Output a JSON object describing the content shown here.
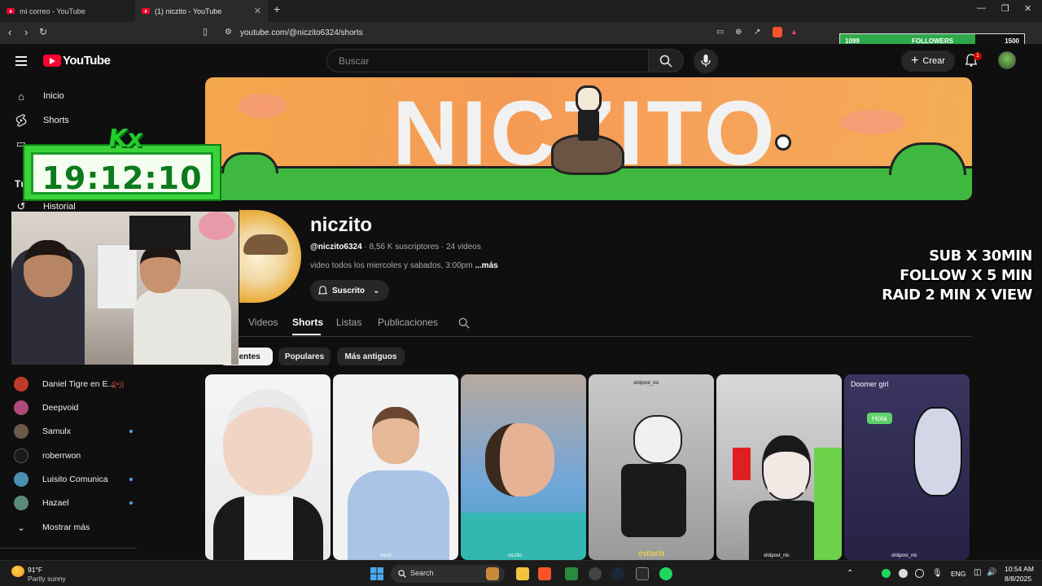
{
  "browser": {
    "tabs": [
      {
        "title": "mi correo - YouTube"
      },
      {
        "title": "(1) niczito - YouTube"
      }
    ],
    "url": "youtube.com/@niczito6324/shorts"
  },
  "header": {
    "logo": "YouTube",
    "search_placeholder": "Buscar",
    "create_label": "Crear",
    "notification_count": "1"
  },
  "followers_overlay": {
    "current": "1099",
    "label": "FOLLOWERS",
    "goal": "1500",
    "progress": 0.733
  },
  "sidebar": {
    "items": [
      {
        "label": "Inicio",
        "icon": "home-icon"
      },
      {
        "label": "Shorts",
        "icon": "shorts-icon"
      },
      {
        "label": "Historial",
        "icon": "history-icon"
      }
    ],
    "section_partial": "Tú",
    "subscriptions": [
      {
        "name": "Daniel Tigre en E...",
        "live": true,
        "color": "#c0392b"
      },
      {
        "name": "Deepvoid",
        "live": false,
        "color": "#b04a7a"
      },
      {
        "name": "Samulx",
        "live": true,
        "color": "#6b5a4a"
      },
      {
        "name": "roberrwon",
        "live": false,
        "color": "#1a1a1a"
      },
      {
        "name": "Luisito Comunica",
        "live": true,
        "color": "#4a90b0"
      },
      {
        "name": "Hazael",
        "live": true,
        "color": "#5a8a7a"
      }
    ],
    "show_more": "Mostrar más"
  },
  "banner": {
    "text": "NICZITO"
  },
  "channel": {
    "name": "niczito",
    "handle": "@niczito6324",
    "subscribers": "8,56 K suscriptores",
    "video_count": "24 videos",
    "description": "video todos los miercoles y sabados, 3:00pm",
    "more": "...más",
    "subscribed_label": "Suscrito"
  },
  "stream_overlay": {
    "lines": [
      "SUB X 30MIN",
      "FOLLOW X 5 MIN",
      "RAID 2 MIN X VIEW"
    ],
    "timer": "19:12:10",
    "logo": "Kx"
  },
  "channel_tabs": [
    {
      "label": "Videos",
      "active": false
    },
    {
      "label": "Shorts",
      "active": true
    },
    {
      "label": "Listas",
      "active": false
    },
    {
      "label": "Publicaciones",
      "active": false
    }
  ],
  "chips": [
    {
      "label": "cientes",
      "active": true
    },
    {
      "label": "Populares",
      "active": false
    },
    {
      "label": "Más antiguos",
      "active": false
    }
  ],
  "shorts": [
    {
      "tag": "niczit",
      "caption": ""
    },
    {
      "tag": "niczit",
      "caption": ""
    },
    {
      "tag": "niczito",
      "caption": ""
    },
    {
      "tag": "shitpost_nic",
      "caption": "evitarla"
    },
    {
      "tag": "shitpost_nic",
      "caption": ""
    },
    {
      "tag": "shitpost_nic",
      "caption": "",
      "bubble1": "Doomer girl",
      "bubble2": "Hola"
    }
  ],
  "taskbar": {
    "weather_temp": "91°F",
    "weather_desc": "Partly sunny",
    "search_label": "Search",
    "language": "ENG",
    "time": "10:54 AM",
    "date": "8/8/2025"
  }
}
